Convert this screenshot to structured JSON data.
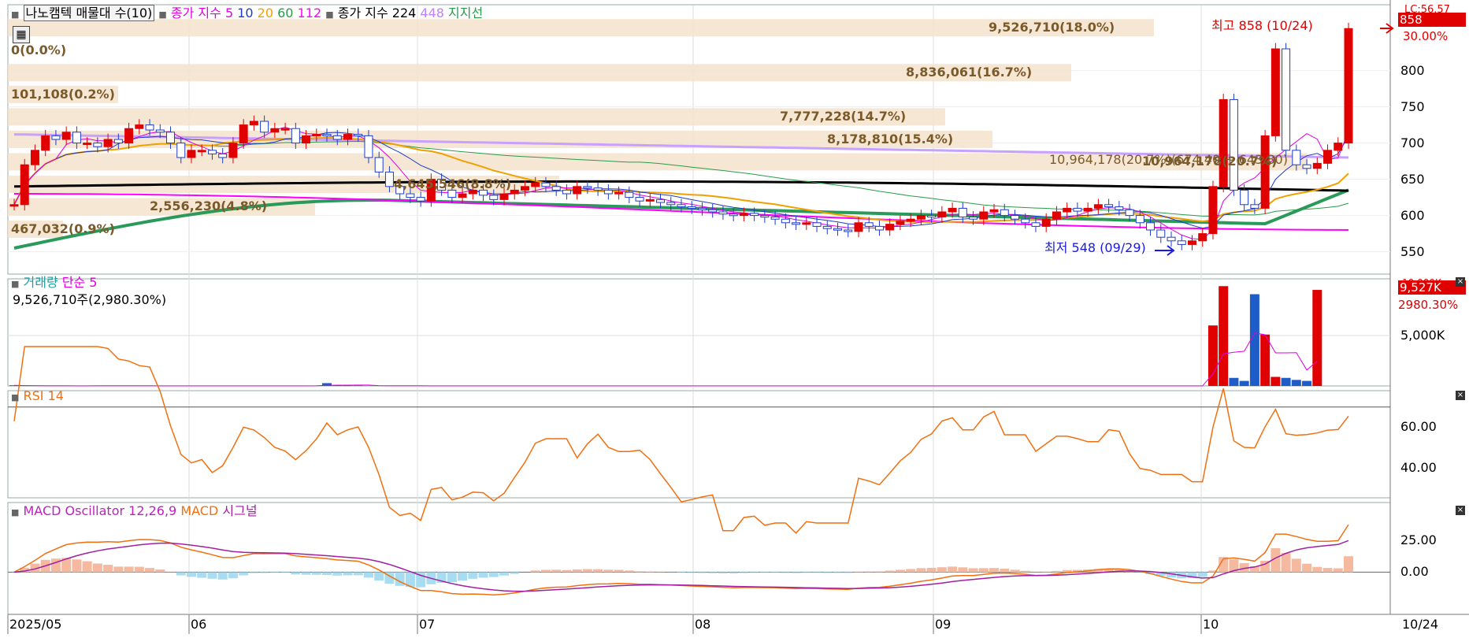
{
  "price_panel": {
    "title": "나노캠텍 매물대 수(10)",
    "ma_label": "종가 지수",
    "ma_periods": [
      "5",
      "10",
      "20",
      "60",
      "112"
    ],
    "ma_colors": [
      "#e000e0",
      "#1e3cc8",
      "#f0a000",
      "#2a9a4a",
      "#ff00ff"
    ],
    "long_ma_label": "종가 지수 224",
    "long_ma_extra": "448",
    "support_label": "지지선",
    "y_ticks": [
      "800",
      "750",
      "700",
      "650",
      "600",
      "550"
    ],
    "current_price": "858",
    "current_change": "30.00%",
    "lc_label": "LC:56.57",
    "high_label": "최고 858 (10/24)",
    "low_label": "최저 548 (09/29)",
    "range_label": "10,964,178(20.7%)(674.40 ~ 643.80)",
    "volume_profile": [
      {
        "label": "9,526,710(18.0%)",
        "price": 858
      },
      {
        "label": "0(0.0%)",
        "price": 827
      },
      {
        "label": "8,836,061(16.7%)",
        "price": 796
      },
      {
        "label": "101,108(0.2%)",
        "price": 766
      },
      {
        "label": "7,777,228(14.7%)",
        "price": 735
      },
      {
        "label": "8,178,810(15.4%)",
        "price": 704
      },
      {
        "label": "10,964,178(20.7%)",
        "price": 673
      },
      {
        "label": "4,645,546(8.8%)",
        "price": 642
      },
      {
        "label": "2,556,230(4.8%)",
        "price": 611
      },
      {
        "label": "467,032(0.9%)",
        "price": 580
      }
    ]
  },
  "volume_panel": {
    "title": "거래량",
    "ma_label": "단순 5",
    "value_text": "9,526,710주(2,980.30%)",
    "tick": "5,000K",
    "current_value": "9,527K",
    "current_change": "2980.30%",
    "top_tick": "10,000K"
  },
  "rsi_panel": {
    "title": "RSI 14",
    "ticks": [
      "60.00",
      "40.00"
    ]
  },
  "macd_panel": {
    "title": "MACD Oscillator 12,26,9",
    "macd_label": "MACD",
    "signal_label": "시그널",
    "ticks": [
      "25.00",
      "0.00"
    ]
  },
  "x_axis": {
    "labels": [
      "2025/05",
      "06",
      "07",
      "08",
      "09",
      "10"
    ],
    "right_label": "10/24"
  },
  "chart_data": {
    "type": "candlestick",
    "series": [
      {
        "name": "종가",
        "values": [
          615,
          670,
          690,
          710,
          705,
          715,
          700,
          700,
          695,
          705,
          700,
          720,
          725,
          718,
          715,
          700,
          680,
          690,
          690,
          685,
          680,
          700,
          725,
          730,
          715,
          720,
          720,
          700,
          710,
          712,
          710,
          705,
          712,
          710,
          680,
          660,
          640,
          630,
          625,
          620,
          650,
          635,
          625,
          630,
          635,
          628,
          622,
          630,
          635,
          640,
          645,
          640,
          635,
          630,
          640,
          638,
          635,
          630,
          632,
          625,
          620,
          622,
          618,
          615,
          612,
          610,
          608,
          605,
          602,
          600,
          603,
          600,
          598,
          595,
          590,
          588,
          590,
          585,
          582,
          580,
          578,
          590,
          585,
          580,
          588,
          592,
          595,
          600,
          598,
          605,
          610,
          598,
          595,
          605,
          608,
          600,
          595,
          590,
          585,
          595,
          605,
          610,
          606,
          610,
          615,
          612,
          608,
          600,
          590,
          580,
          570,
          565,
          560,
          565,
          575,
          640,
          760,
          635,
          615,
          610,
          710,
          830,
          690,
          670,
          665,
          672,
          690,
          700,
          858
        ]
      },
      {
        "name": "거래량",
        "values": [
          60,
          20,
          10,
          15,
          10,
          10,
          10,
          10,
          20,
          20,
          10,
          10,
          15,
          10,
          10,
          10,
          10,
          10,
          10,
          10,
          10,
          10,
          10,
          10,
          10,
          10,
          10,
          10,
          10,
          20,
          280,
          60,
          30,
          40,
          10,
          20,
          10,
          10,
          10,
          10,
          10,
          10,
          10,
          10,
          10,
          10,
          10,
          10,
          10,
          10,
          10,
          10,
          10,
          10,
          10,
          10,
          10,
          10,
          10,
          10,
          10,
          10,
          10,
          10,
          10,
          10,
          10,
          10,
          10,
          10,
          10,
          10,
          10,
          10,
          10,
          10,
          10,
          10,
          10,
          10,
          10,
          10,
          10,
          10,
          10,
          10,
          10,
          10,
          10,
          10,
          10,
          10,
          10,
          10,
          10,
          10,
          10,
          10,
          10,
          10,
          10,
          10,
          10,
          10,
          10,
          10,
          10,
          10,
          10,
          10,
          10,
          10,
          10,
          10,
          10,
          6000,
          9900,
          800,
          500,
          9100,
          5100,
          900,
          800,
          600,
          500,
          9527
        ]
      }
    ],
    "y_range": [
      530,
      880
    ]
  }
}
